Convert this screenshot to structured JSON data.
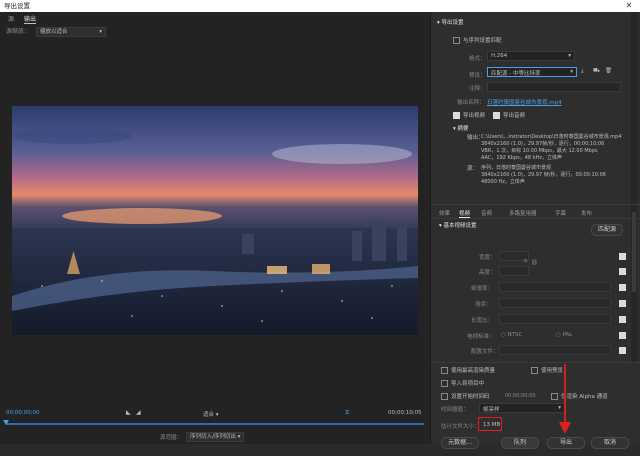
{
  "window": {
    "title": "导出设置",
    "close_glyph": "✕"
  },
  "left": {
    "tabs": [
      "源",
      "输出"
    ],
    "source_scaling_label": "源缩放：",
    "source_scaling_value": "缩放以适合",
    "timecode_start": "00;00;00;00",
    "timecode_end": "00;00;10;05",
    "fit_label": "适合",
    "range_label": "源范围：",
    "range_value": "序列切入/序列切出"
  },
  "right": {
    "export_settings_title": "导出设置",
    "match_sequence_label": "与序列设置匹配",
    "format_label": "格式：",
    "format_value": "H.264",
    "preset_label": "预设：",
    "preset_value": "匹配源 - 中等比特率",
    "comment_label": "注释：",
    "output_name_label": "输出名称：",
    "output_name_value": "日落时泰国曼谷城市景观.mp4",
    "export_video_label": "导出视频",
    "export_audio_label": "导出音频",
    "summary_title": "摘要",
    "summary_output_label": "输出：",
    "summary_output_lines": [
      "C:\\Users\\...instrator\\Desktop\\日落时泰国曼谷城市景观.mp4",
      "3840x2160 (1.0)，29.97帧/秒，逐行，00;00;10;06",
      "VBR，1 次，目标 10.00 Mbps，最大 12.00 Mbps",
      "AAC，192 Kbps，48 kHz，立体声"
    ],
    "summary_source_label": "源：",
    "summary_source_lines": [
      "序列，日落时泰国曼谷城市景观",
      "3840x2160 (1.0)，29.97 帧/秒，逐行，00;00;10;06",
      "48000 Hz，立体声"
    ],
    "tabs": [
      "效果",
      "视频",
      "音频",
      "多路复用器",
      "字幕",
      "发布"
    ],
    "basic_video_title": "基本视频设置",
    "match_source_button": "匹配源",
    "settings_rows": [
      "宽度：",
      "高度：",
      "帧速率：",
      "场序：",
      "长宽比：",
      "电视标准：",
      "配置文件："
    ],
    "ntsc_label": "NTSC",
    "pal_label": "PAL",
    "use_max_render_label": "使用最高渲染质量",
    "use_preview_label": "使用预览",
    "import_project_label": "导入到项目中",
    "set_start_timecode_label": "设置开始时间码",
    "start_timecode_value": "00;00;00;00",
    "render_alpha_label": "仅渲染 Alpha 通道",
    "time_interp_label": "时间插值：",
    "time_interp_value": "帧采样",
    "file_size_label": "估计文件大小：",
    "file_size_value": "13 MB",
    "metadata_button": "元数据...",
    "queue_button": "队列",
    "export_button": "导出",
    "cancel_button": "取消"
  },
  "colors": {
    "accent": "#4aa0e6",
    "highlight": "#e02020"
  }
}
